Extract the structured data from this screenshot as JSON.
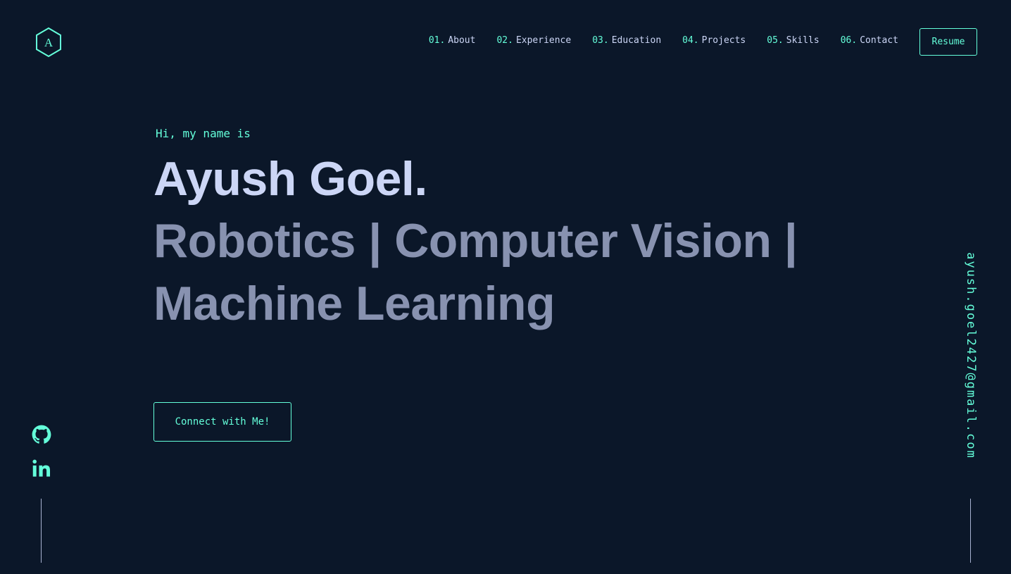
{
  "logo": {
    "letter": "A",
    "icon": "hexagon-logo-icon"
  },
  "nav": {
    "items": [
      {
        "num": "01.",
        "label": "About"
      },
      {
        "num": "02.",
        "label": "Experience"
      },
      {
        "num": "03.",
        "label": "Education"
      },
      {
        "num": "04.",
        "label": "Projects"
      },
      {
        "num": "05.",
        "label": "Skills"
      },
      {
        "num": "06.",
        "label": "Contact"
      }
    ],
    "resume_label": "Resume"
  },
  "hero": {
    "greeting": "Hi, my name is",
    "name": "Ayush Goel.",
    "tagline": "Robotics | Computer Vision | Machine Learning",
    "cta_label": "Connect with Me!"
  },
  "social": [
    {
      "icon": "github-icon"
    },
    {
      "icon": "linkedin-icon"
    }
  ],
  "email": "ayush.goel2427@gmail.com",
  "colors": {
    "background": "#0b1729",
    "accent": "#64ffda",
    "heading": "#ccd6f6",
    "subheading": "#8892b0"
  }
}
